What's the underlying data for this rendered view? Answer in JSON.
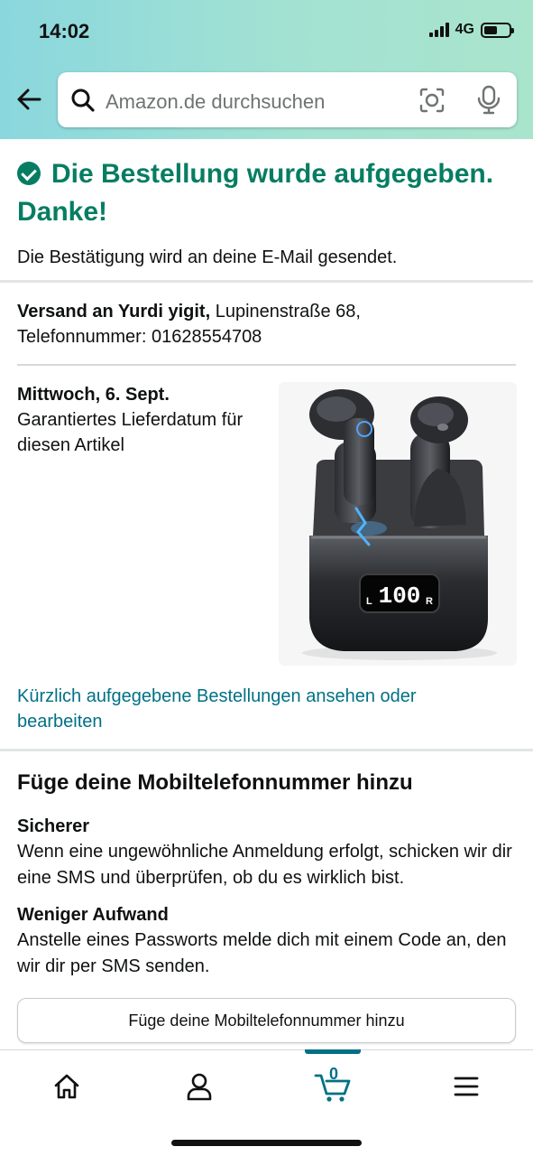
{
  "status_bar": {
    "time": "14:02",
    "network": "4G"
  },
  "search": {
    "placeholder": "Amazon.de durchsuchen"
  },
  "confirmation": {
    "title": "Die Bestellung wurde aufgegeben. Danke!",
    "subtitle": "Die Bestätigung wird an deine E-Mail gesendet."
  },
  "shipping": {
    "label": "Versand an Yurdi yigit,",
    "address": "Lupinenstraße 68,",
    "phone": "Telefonnummer: 01628554708"
  },
  "delivery": {
    "date": "Mittwoch, 6. Sept.",
    "note": "Garantiertes Lieferdatum für diesen Artikel"
  },
  "product": {
    "display_text": "100",
    "left_mark": "L",
    "right_mark": "R"
  },
  "orders_link": "Kürzlich aufgegebene Bestellungen ansehen oder bearbeiten",
  "mobile": {
    "heading": "Füge deine Mobiltelefonnummer hinzu",
    "benefits": [
      {
        "title": "Sicherer",
        "text": "Wenn eine ungewöhnliche Anmeldung erfolgt, schicken wir dir eine SMS und überprüfen, ob du es wirklich bist."
      },
      {
        "title": "Weniger Aufwand",
        "text": "Anstelle eines Passworts melde dich mit einem Code an, den wir dir per SMS senden."
      }
    ],
    "button_label": "Füge deine Mobiltelefonnummer hinzu"
  },
  "nav": {
    "cart_count": "0"
  },
  "colors": {
    "success": "#067d62",
    "link": "#007185",
    "header_gradient_start": "#8ad7de",
    "header_gradient_end": "#a9e4cd"
  },
  "icons": [
    "back-arrow-icon",
    "search-icon",
    "camera-scan-icon",
    "microphone-icon",
    "check-circle-icon",
    "home-icon",
    "account-icon",
    "cart-icon",
    "menu-icon"
  ]
}
